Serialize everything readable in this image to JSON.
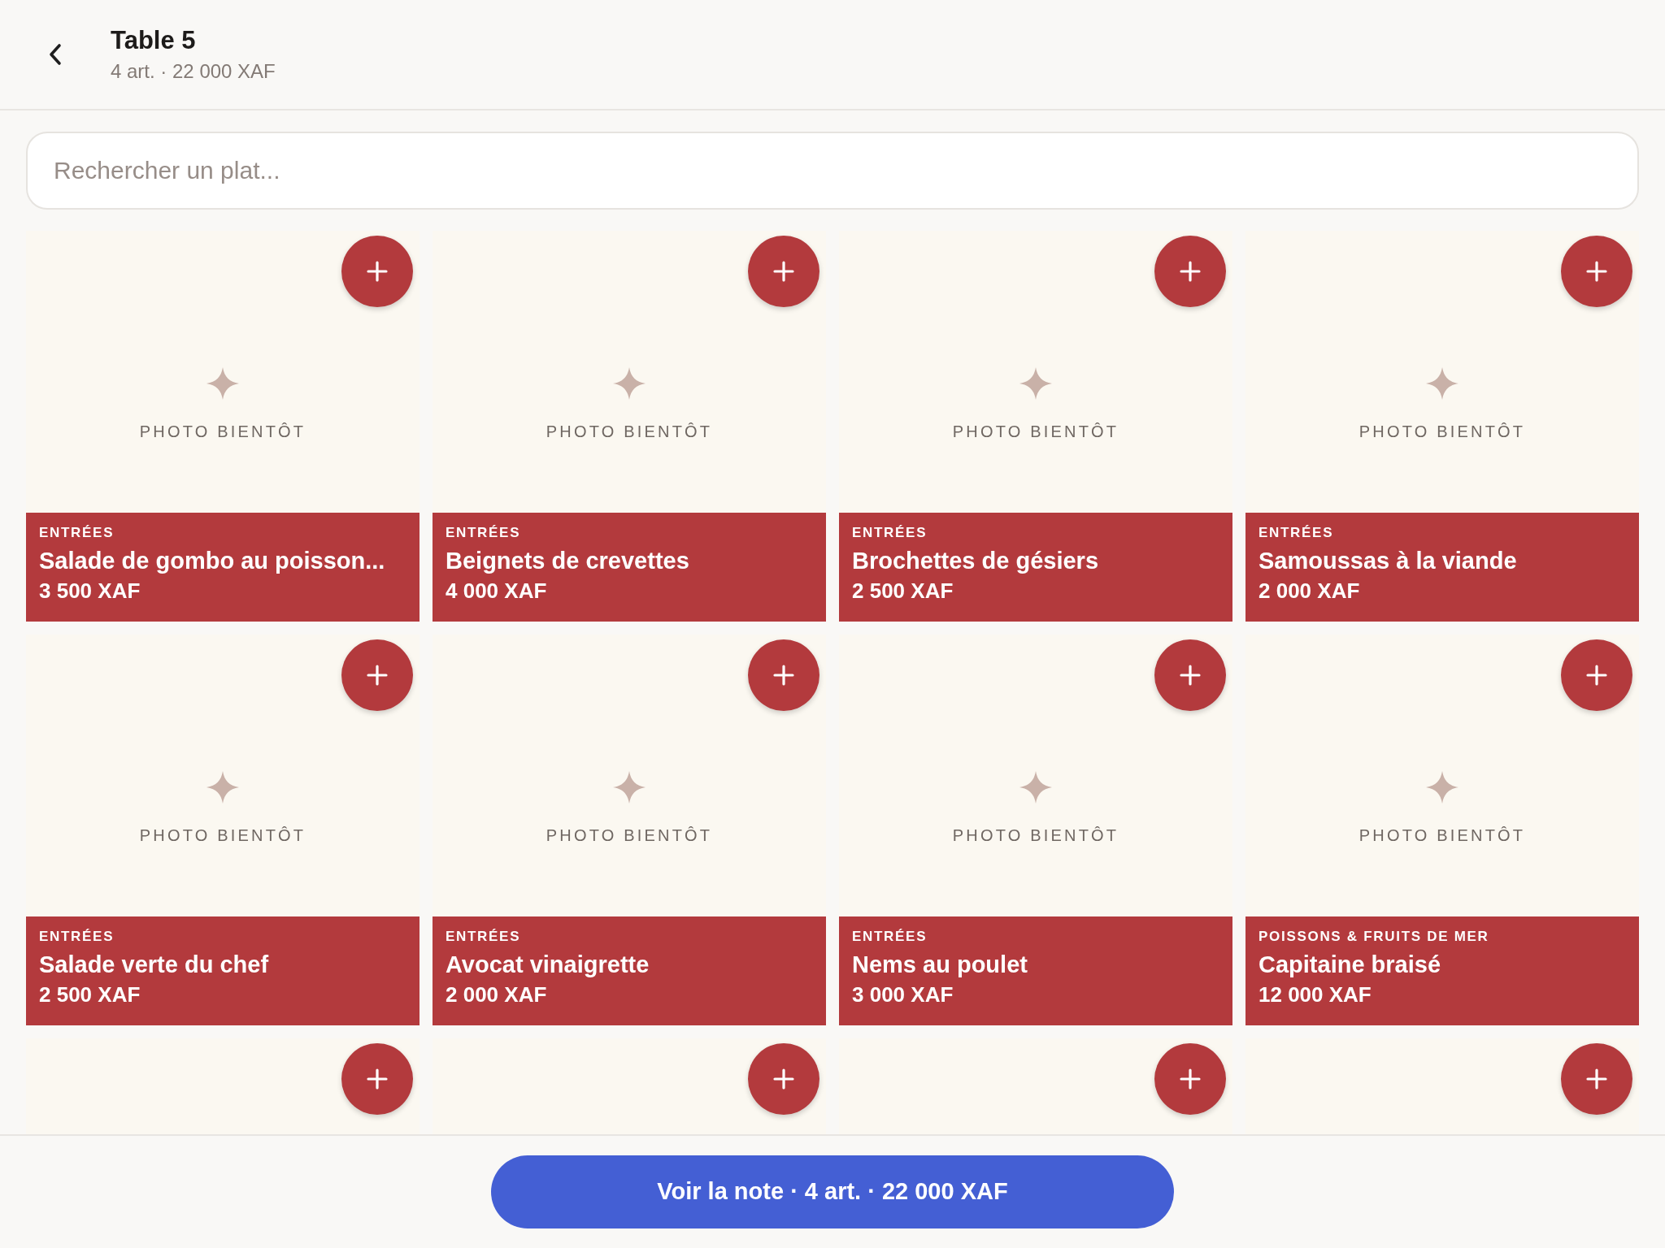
{
  "header": {
    "title": "Table 5",
    "subtitle": "4 art. · 22 000 XAF"
  },
  "search": {
    "placeholder": "Rechercher un plat..."
  },
  "items": [
    {
      "kind": "full",
      "placeholder": "PHOTO BIENTÔT",
      "category": "ENTRÉES",
      "name": "Salade de gombo au poisson...",
      "price": "3 500 XAF"
    },
    {
      "kind": "full",
      "placeholder": "PHOTO BIENTÔT",
      "category": "ENTRÉES",
      "name": "Beignets de crevettes",
      "price": "4 000 XAF"
    },
    {
      "kind": "full",
      "placeholder": "PHOTO BIENTÔT",
      "category": "ENTRÉES",
      "name": "Brochettes de gésiers",
      "price": "2 500 XAF"
    },
    {
      "kind": "full",
      "placeholder": "PHOTO BIENTÔT",
      "category": "ENTRÉES",
      "name": "Samoussas à la viande",
      "price": "2 000 XAF"
    },
    {
      "kind": "full",
      "placeholder": "PHOTO BIENTÔT",
      "category": "ENTRÉES",
      "name": "Salade verte du chef",
      "price": "2 500 XAF"
    },
    {
      "kind": "full",
      "placeholder": "PHOTO BIENTÔT",
      "category": "ENTRÉES",
      "name": "Avocat vinaigrette",
      "price": "2 000 XAF"
    },
    {
      "kind": "full",
      "placeholder": "PHOTO BIENTÔT",
      "category": "ENTRÉES",
      "name": "Nems au poulet",
      "price": "3 000 XAF"
    },
    {
      "kind": "full",
      "placeholder": "PHOTO BIENTÔT",
      "category": "POISSONS & FRUITS DE MER",
      "name": "Capitaine braisé",
      "price": "12 000 XAF"
    },
    {
      "kind": "cut"
    },
    {
      "kind": "cut"
    },
    {
      "kind": "cut"
    },
    {
      "kind": "cut"
    }
  ],
  "footer": {
    "button": "Voir la note · 4 art. · 22 000 XAF"
  }
}
